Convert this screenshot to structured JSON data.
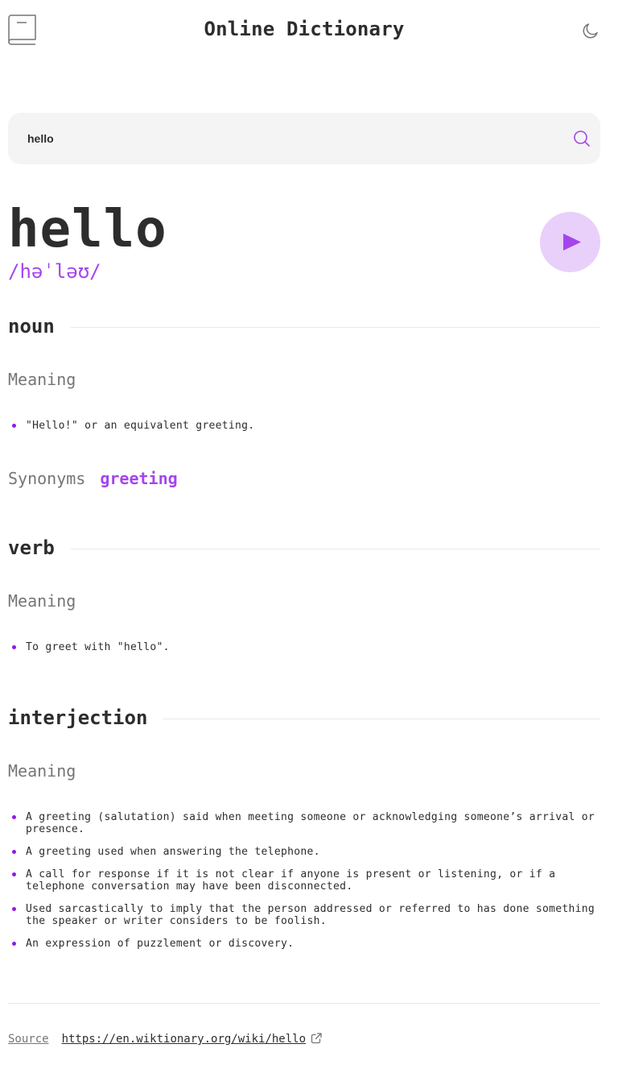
{
  "header": {
    "title": "Online Dictionary",
    "logo_icon": "book-icon",
    "theme_icon": "moon-icon"
  },
  "search": {
    "value": "hello",
    "placeholder": "",
    "icon": "search-icon"
  },
  "entry": {
    "word": "hello",
    "phonetic": "/həˈləʊ/",
    "play_icon": "play-icon",
    "meanings": [
      {
        "part_of_speech": "noun",
        "meaning_label": "Meaning",
        "definitions": [
          "\"Hello!\" or an equivalent greeting."
        ],
        "synonyms_label": "Synonyms",
        "synonyms": [
          "greeting"
        ]
      },
      {
        "part_of_speech": "verb",
        "meaning_label": "Meaning",
        "definitions": [
          "To greet with \"hello\"."
        ]
      },
      {
        "part_of_speech": "interjection",
        "meaning_label": "Meaning",
        "definitions": [
          "A greeting (salutation) said when meeting someone or acknowledging someone’s arrival or presence.",
          "A greeting used when answering the telephone.",
          "A call for response if it is not clear if anyone is present or listening, or if a telephone conversation may have been disconnected.",
          "Used sarcastically to imply that the person addressed or referred to has done something the speaker or writer considers to be foolish.",
          "An expression of puzzlement or discovery."
        ]
      }
    ]
  },
  "footer": {
    "source_label": "Source",
    "source_url": "https://en.wiktionary.org/wiki/hello",
    "external_icon": "external-link-icon"
  },
  "colors": {
    "accent": "#a445ed",
    "play_bg": "#e9d0fa",
    "text": "#2d2d2d",
    "muted": "#757575",
    "search_bg": "#f4f4f4"
  }
}
